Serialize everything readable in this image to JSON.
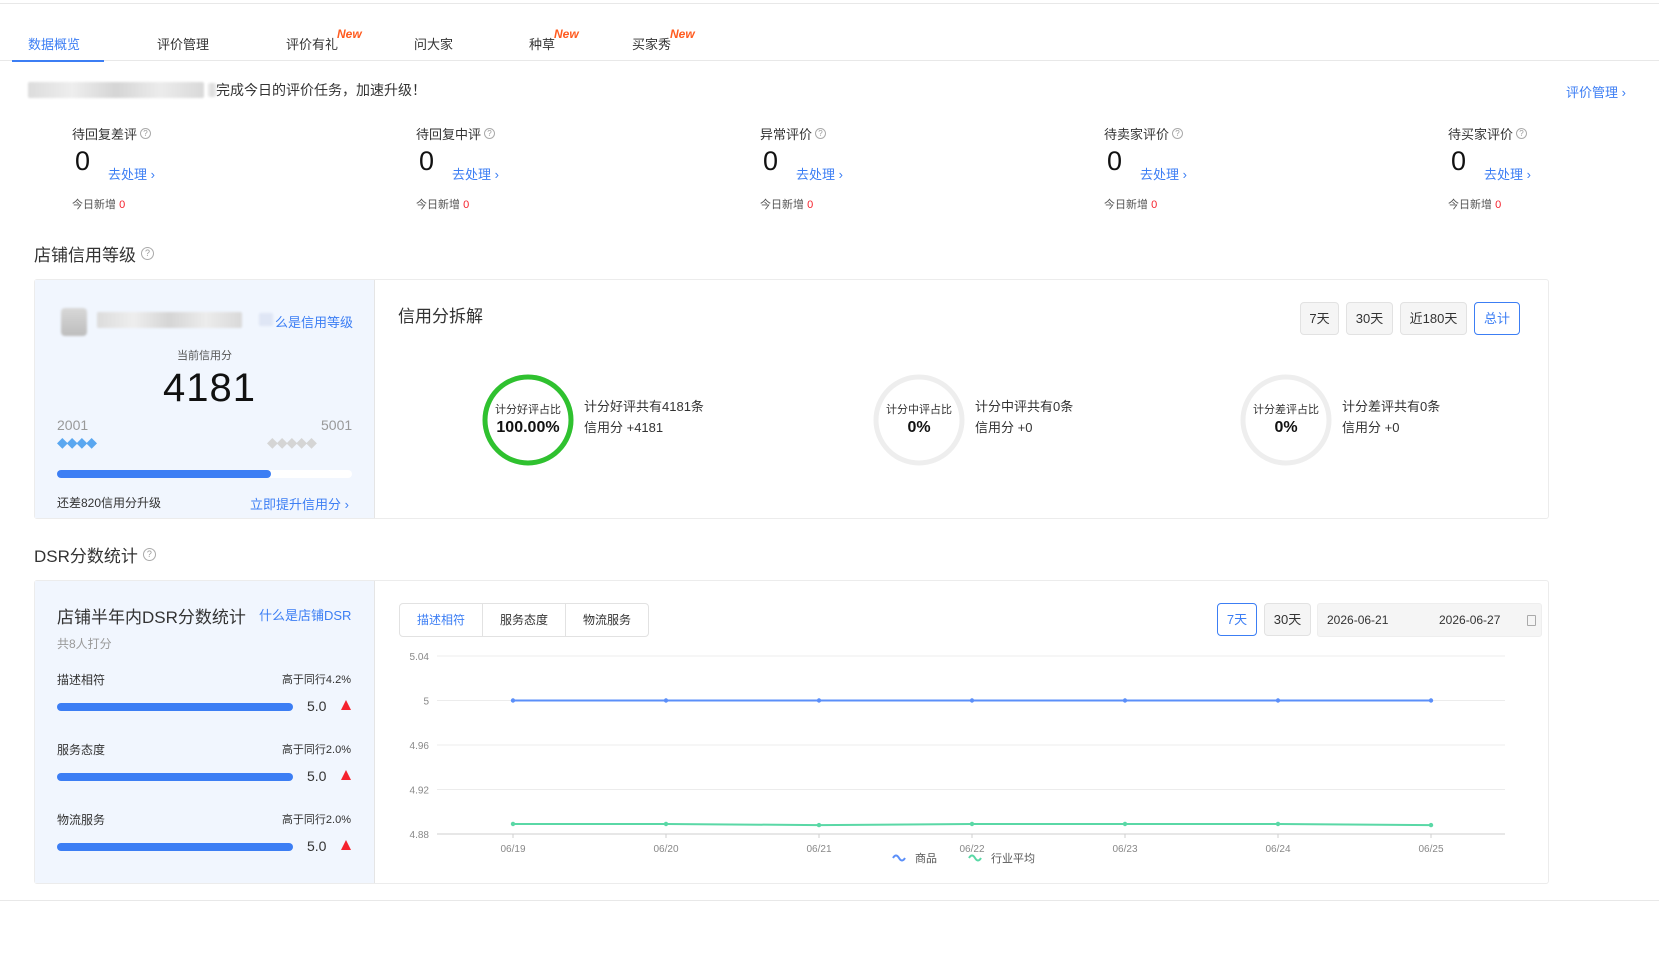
{
  "tabs": [
    {
      "label": "数据概览",
      "badge": ""
    },
    {
      "label": "评价管理",
      "badge": ""
    },
    {
      "label": "评价有礼",
      "badge": "New"
    },
    {
      "label": "问大家",
      "badge": ""
    },
    {
      "label": "种草",
      "badge": "New"
    },
    {
      "label": "买家秀",
      "badge": "New"
    }
  ],
  "notice": {
    "text": "完成今日的评价任务，加速升级！",
    "manage_link": "评价管理"
  },
  "stats": [
    {
      "title": "待回复差评",
      "value": "0",
      "action": "去处理",
      "new_label": "今日新增",
      "new_value": "0"
    },
    {
      "title": "待回复中评",
      "value": "0",
      "action": "去处理",
      "new_label": "今日新增",
      "new_value": "0"
    },
    {
      "title": "异常评价",
      "value": "0",
      "action": "去处理",
      "new_label": "今日新增",
      "new_value": "0"
    },
    {
      "title": "待卖家评价",
      "value": "0",
      "action": "去处理",
      "new_label": "今日新增",
      "new_value": "0"
    },
    {
      "title": "待买家评价",
      "value": "0",
      "action": "去处理",
      "new_label": "今日新增",
      "new_value": "0"
    }
  ],
  "credit": {
    "section_title": "店铺信用等级",
    "what_link": "么是信用等级",
    "current_label": "当前信用分",
    "current_value": "4181",
    "range_low": "2001",
    "range_high": "5001",
    "progress": 0.725,
    "remain_text": "还差820信用分升级",
    "improve_link": "立即提升信用分",
    "breakdown_title": "信用分拆解",
    "periods": [
      "7天",
      "30天",
      "近180天",
      "总计"
    ],
    "active_period": 3,
    "rings": [
      {
        "label": "计分好评占比",
        "pct": "100.00%",
        "ratio": 1,
        "color": "#2fc12f",
        "line1": "计分好评共有4181条",
        "line2": "信用分 +4181"
      },
      {
        "label": "计分中评占比",
        "pct": "0%",
        "ratio": 0,
        "color": "#eeeeee",
        "line1": "计分中评共有0条",
        "line2": "信用分 +0"
      },
      {
        "label": "计分差评占比",
        "pct": "0%",
        "ratio": 0,
        "color": "#eeeeee",
        "line1": "计分差评共有0条",
        "line2": "信用分 +0"
      }
    ]
  },
  "dsr": {
    "section_title": "DSR分数统计",
    "card_title": "店铺半年内DSR分数统计",
    "what_link": "什么是店铺DSR",
    "raters": "共8人打分",
    "rows": [
      {
        "label": "描述相符",
        "compare": "高于同行4.2%",
        "score": "5.0",
        "ratio": 1
      },
      {
        "label": "服务态度",
        "compare": "高于同行2.0%",
        "score": "5.0",
        "ratio": 1
      },
      {
        "label": "物流服务",
        "compare": "高于同行2.0%",
        "score": "5.0",
        "ratio": 1
      }
    ],
    "segments": [
      "描述相符",
      "服务态度",
      "物流服务"
    ],
    "active_segment": 0,
    "periods": [
      "7天",
      "30天"
    ],
    "active_period": 0,
    "date_start": "2026-06-21",
    "date_end": "2026-06-27",
    "colors": {
      "product": "#5b8ff9",
      "industry": "#5ad8a6"
    }
  },
  "chart_data": {
    "type": "line",
    "x": [
      "06/19",
      "06/20",
      "06/21",
      "06/22",
      "06/23",
      "06/24",
      "06/25"
    ],
    "yticks": [
      5.04,
      5,
      4.96,
      4.92,
      4.88
    ],
    "ylim": [
      4.88,
      5.04
    ],
    "series": [
      {
        "name": "商品",
        "values": [
          5,
          5,
          5,
          5,
          5,
          5,
          5
        ]
      },
      {
        "name": "行业平均",
        "values": [
          4.889,
          4.889,
          4.888,
          4.889,
          4.889,
          4.889,
          4.888
        ]
      }
    ],
    "legend_position": "bottom-center"
  }
}
